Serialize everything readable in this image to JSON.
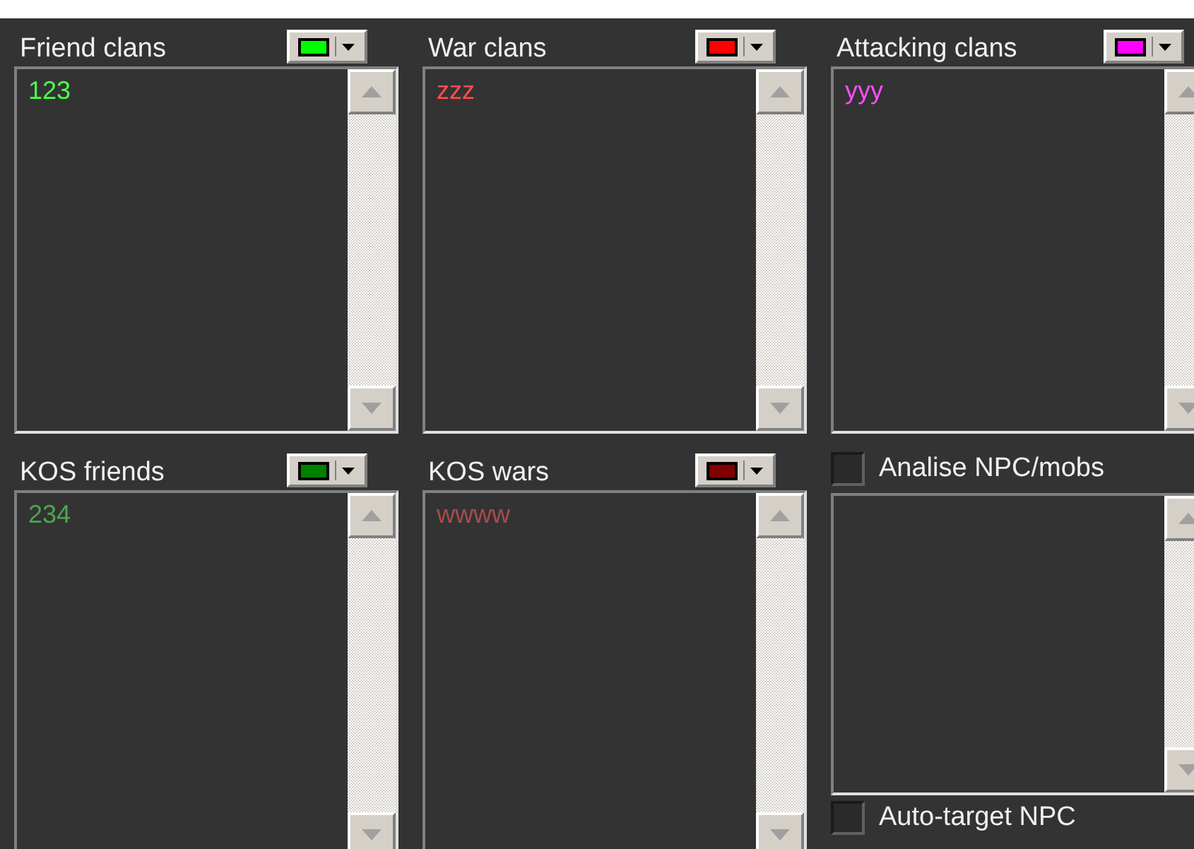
{
  "panels": [
    {
      "kind": "color_list",
      "title": "Friend clans",
      "color": "#00ff00",
      "items": [
        "123"
      ]
    },
    {
      "kind": "color_list",
      "title": "War clans",
      "color": "#ff0000",
      "items": [
        "zzz"
      ]
    },
    {
      "kind": "color_list",
      "title": "Attacking clans",
      "color": "#ff00ff",
      "items": [
        "yyy"
      ]
    },
    {
      "kind": "color_list",
      "title": "KOS friends",
      "color": "#008000",
      "items": [
        "234"
      ]
    },
    {
      "kind": "color_list",
      "title": "KOS wars",
      "color": "#800000",
      "items": [
        "wwww"
      ]
    },
    {
      "kind": "check_list",
      "title": "Analise NPC/mobs",
      "checked": false
    }
  ],
  "extra_checkbox": {
    "label": "Auto-target NPC",
    "checked": false
  }
}
